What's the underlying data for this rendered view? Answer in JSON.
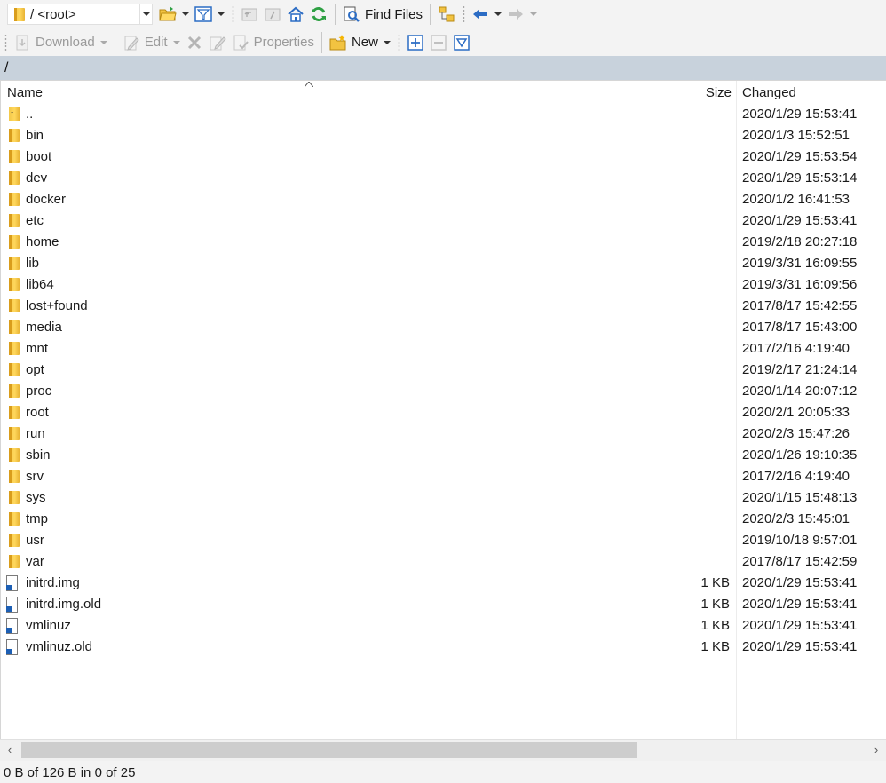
{
  "toolbar1": {
    "path_combo_value": "/ <root>",
    "find_files_label": "Find Files"
  },
  "toolbar2": {
    "download_label": "Download",
    "edit_label": "Edit",
    "properties_label": "Properties",
    "new_label": "New"
  },
  "path_bar": "/",
  "columns": {
    "name": "Name",
    "size": "Size",
    "changed": "Changed"
  },
  "rows": [
    {
      "name": "..",
      "size": "",
      "changed": "2020/1/29 15:53:41",
      "kind": "parent"
    },
    {
      "name": "bin",
      "size": "",
      "changed": "2020/1/3 15:52:51",
      "kind": "folder"
    },
    {
      "name": "boot",
      "size": "",
      "changed": "2020/1/29 15:53:54",
      "kind": "folder"
    },
    {
      "name": "dev",
      "size": "",
      "changed": "2020/1/29 15:53:14",
      "kind": "folder"
    },
    {
      "name": "docker",
      "size": "",
      "changed": "2020/1/2 16:41:53",
      "kind": "folder"
    },
    {
      "name": "etc",
      "size": "",
      "changed": "2020/1/29 15:53:41",
      "kind": "folder"
    },
    {
      "name": "home",
      "size": "",
      "changed": "2019/2/18 20:27:18",
      "kind": "folder"
    },
    {
      "name": "lib",
      "size": "",
      "changed": "2019/3/31 16:09:55",
      "kind": "folder"
    },
    {
      "name": "lib64",
      "size": "",
      "changed": "2019/3/31 16:09:56",
      "kind": "folder"
    },
    {
      "name": "lost+found",
      "size": "",
      "changed": "2017/8/17 15:42:55",
      "kind": "folder"
    },
    {
      "name": "media",
      "size": "",
      "changed": "2017/8/17 15:43:00",
      "kind": "folder"
    },
    {
      "name": "mnt",
      "size": "",
      "changed": "2017/2/16 4:19:40",
      "kind": "folder"
    },
    {
      "name": "opt",
      "size": "",
      "changed": "2019/2/17 21:24:14",
      "kind": "folder"
    },
    {
      "name": "proc",
      "size": "",
      "changed": "2020/1/14 20:07:12",
      "kind": "folder"
    },
    {
      "name": "root",
      "size": "",
      "changed": "2020/2/1 20:05:33",
      "kind": "folder"
    },
    {
      "name": "run",
      "size": "",
      "changed": "2020/2/3 15:47:26",
      "kind": "folder"
    },
    {
      "name": "sbin",
      "size": "",
      "changed": "2020/1/26 19:10:35",
      "kind": "folder"
    },
    {
      "name": "srv",
      "size": "",
      "changed": "2017/2/16 4:19:40",
      "kind": "folder"
    },
    {
      "name": "sys",
      "size": "",
      "changed": "2020/1/15 15:48:13",
      "kind": "folder"
    },
    {
      "name": "tmp",
      "size": "",
      "changed": "2020/2/3 15:45:01",
      "kind": "folder"
    },
    {
      "name": "usr",
      "size": "",
      "changed": "2019/10/18 9:57:01",
      "kind": "folder"
    },
    {
      "name": "var",
      "size": "",
      "changed": "2017/8/17 15:42:59",
      "kind": "folder"
    },
    {
      "name": "initrd.img",
      "size": "1 KB",
      "changed": "2020/1/29 15:53:41",
      "kind": "link"
    },
    {
      "name": "initrd.img.old",
      "size": "1 KB",
      "changed": "2020/1/29 15:53:41",
      "kind": "link"
    },
    {
      "name": "vmlinuz",
      "size": "1 KB",
      "changed": "2020/1/29 15:53:41",
      "kind": "link"
    },
    {
      "name": "vmlinuz.old",
      "size": "1 KB",
      "changed": "2020/1/29 15:53:41",
      "kind": "link"
    }
  ],
  "status_text": "0 B of 126 B in 0 of 25",
  "icons": {
    "open-folder": "open-folder-icon",
    "filter": "filter-icon",
    "parent-dir": "parent-directory-icon",
    "root-dir": "root-directory-icon",
    "home": "home-icon",
    "refresh": "refresh-icon",
    "find": "find-files-icon",
    "tree": "tree-toggle-icon",
    "back": "back-arrow-icon",
    "forward": "forward-arrow-icon",
    "download": "download-icon",
    "edit": "edit-icon",
    "delete": "delete-icon",
    "rename": "rename-icon",
    "properties": "properties-icon",
    "new": "new-folder-icon",
    "select": "select-plus-icon",
    "unselect": "select-minus-icon",
    "filter-select": "filter-select-icon"
  },
  "colors": {
    "accent_blue": "#1d5fb4",
    "folder_yellow": "#ffd75c",
    "path_bar_bg": "#c8d2dc",
    "refresh_green": "#2ea043"
  }
}
